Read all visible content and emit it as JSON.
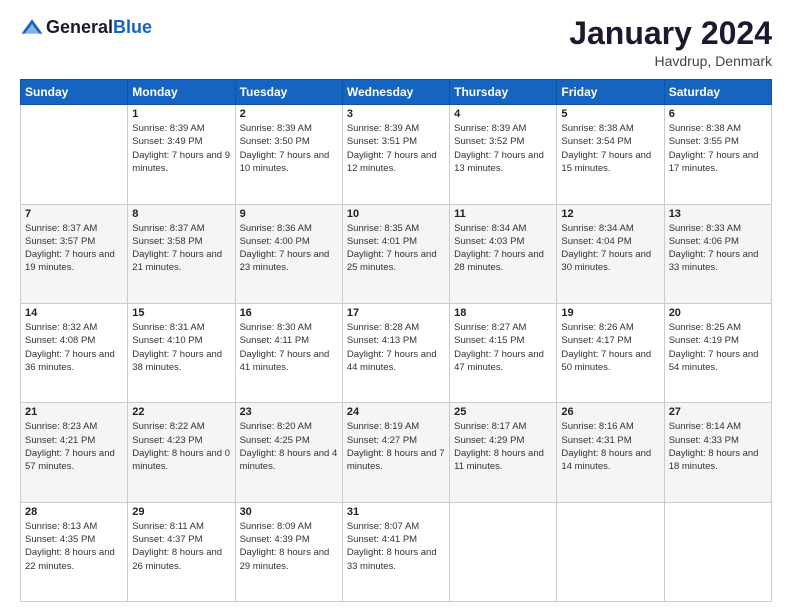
{
  "header": {
    "logo_general": "General",
    "logo_blue": "Blue",
    "month_title": "January 2024",
    "location": "Havdrup, Denmark"
  },
  "days_of_week": [
    "Sunday",
    "Monday",
    "Tuesday",
    "Wednesday",
    "Thursday",
    "Friday",
    "Saturday"
  ],
  "weeks": [
    [
      {
        "num": "",
        "empty": true
      },
      {
        "num": "1",
        "sunrise": "Sunrise: 8:39 AM",
        "sunset": "Sunset: 3:49 PM",
        "daylight": "Daylight: 7 hours and 9 minutes."
      },
      {
        "num": "2",
        "sunrise": "Sunrise: 8:39 AM",
        "sunset": "Sunset: 3:50 PM",
        "daylight": "Daylight: 7 hours and 10 minutes."
      },
      {
        "num": "3",
        "sunrise": "Sunrise: 8:39 AM",
        "sunset": "Sunset: 3:51 PM",
        "daylight": "Daylight: 7 hours and 12 minutes."
      },
      {
        "num": "4",
        "sunrise": "Sunrise: 8:39 AM",
        "sunset": "Sunset: 3:52 PM",
        "daylight": "Daylight: 7 hours and 13 minutes."
      },
      {
        "num": "5",
        "sunrise": "Sunrise: 8:38 AM",
        "sunset": "Sunset: 3:54 PM",
        "daylight": "Daylight: 7 hours and 15 minutes."
      },
      {
        "num": "6",
        "sunrise": "Sunrise: 8:38 AM",
        "sunset": "Sunset: 3:55 PM",
        "daylight": "Daylight: 7 hours and 17 minutes."
      }
    ],
    [
      {
        "num": "7",
        "sunrise": "Sunrise: 8:37 AM",
        "sunset": "Sunset: 3:57 PM",
        "daylight": "Daylight: 7 hours and 19 minutes."
      },
      {
        "num": "8",
        "sunrise": "Sunrise: 8:37 AM",
        "sunset": "Sunset: 3:58 PM",
        "daylight": "Daylight: 7 hours and 21 minutes."
      },
      {
        "num": "9",
        "sunrise": "Sunrise: 8:36 AM",
        "sunset": "Sunset: 4:00 PM",
        "daylight": "Daylight: 7 hours and 23 minutes."
      },
      {
        "num": "10",
        "sunrise": "Sunrise: 8:35 AM",
        "sunset": "Sunset: 4:01 PM",
        "daylight": "Daylight: 7 hours and 25 minutes."
      },
      {
        "num": "11",
        "sunrise": "Sunrise: 8:34 AM",
        "sunset": "Sunset: 4:03 PM",
        "daylight": "Daylight: 7 hours and 28 minutes."
      },
      {
        "num": "12",
        "sunrise": "Sunrise: 8:34 AM",
        "sunset": "Sunset: 4:04 PM",
        "daylight": "Daylight: 7 hours and 30 minutes."
      },
      {
        "num": "13",
        "sunrise": "Sunrise: 8:33 AM",
        "sunset": "Sunset: 4:06 PM",
        "daylight": "Daylight: 7 hours and 33 minutes."
      }
    ],
    [
      {
        "num": "14",
        "sunrise": "Sunrise: 8:32 AM",
        "sunset": "Sunset: 4:08 PM",
        "daylight": "Daylight: 7 hours and 36 minutes."
      },
      {
        "num": "15",
        "sunrise": "Sunrise: 8:31 AM",
        "sunset": "Sunset: 4:10 PM",
        "daylight": "Daylight: 7 hours and 38 minutes."
      },
      {
        "num": "16",
        "sunrise": "Sunrise: 8:30 AM",
        "sunset": "Sunset: 4:11 PM",
        "daylight": "Daylight: 7 hours and 41 minutes."
      },
      {
        "num": "17",
        "sunrise": "Sunrise: 8:28 AM",
        "sunset": "Sunset: 4:13 PM",
        "daylight": "Daylight: 7 hours and 44 minutes."
      },
      {
        "num": "18",
        "sunrise": "Sunrise: 8:27 AM",
        "sunset": "Sunset: 4:15 PM",
        "daylight": "Daylight: 7 hours and 47 minutes."
      },
      {
        "num": "19",
        "sunrise": "Sunrise: 8:26 AM",
        "sunset": "Sunset: 4:17 PM",
        "daylight": "Daylight: 7 hours and 50 minutes."
      },
      {
        "num": "20",
        "sunrise": "Sunrise: 8:25 AM",
        "sunset": "Sunset: 4:19 PM",
        "daylight": "Daylight: 7 hours and 54 minutes."
      }
    ],
    [
      {
        "num": "21",
        "sunrise": "Sunrise: 8:23 AM",
        "sunset": "Sunset: 4:21 PM",
        "daylight": "Daylight: 7 hours and 57 minutes."
      },
      {
        "num": "22",
        "sunrise": "Sunrise: 8:22 AM",
        "sunset": "Sunset: 4:23 PM",
        "daylight": "Daylight: 8 hours and 0 minutes."
      },
      {
        "num": "23",
        "sunrise": "Sunrise: 8:20 AM",
        "sunset": "Sunset: 4:25 PM",
        "daylight": "Daylight: 8 hours and 4 minutes."
      },
      {
        "num": "24",
        "sunrise": "Sunrise: 8:19 AM",
        "sunset": "Sunset: 4:27 PM",
        "daylight": "Daylight: 8 hours and 7 minutes."
      },
      {
        "num": "25",
        "sunrise": "Sunrise: 8:17 AM",
        "sunset": "Sunset: 4:29 PM",
        "daylight": "Daylight: 8 hours and 11 minutes."
      },
      {
        "num": "26",
        "sunrise": "Sunrise: 8:16 AM",
        "sunset": "Sunset: 4:31 PM",
        "daylight": "Daylight: 8 hours and 14 minutes."
      },
      {
        "num": "27",
        "sunrise": "Sunrise: 8:14 AM",
        "sunset": "Sunset: 4:33 PM",
        "daylight": "Daylight: 8 hours and 18 minutes."
      }
    ],
    [
      {
        "num": "28",
        "sunrise": "Sunrise: 8:13 AM",
        "sunset": "Sunset: 4:35 PM",
        "daylight": "Daylight: 8 hours and 22 minutes."
      },
      {
        "num": "29",
        "sunrise": "Sunrise: 8:11 AM",
        "sunset": "Sunset: 4:37 PM",
        "daylight": "Daylight: 8 hours and 26 minutes."
      },
      {
        "num": "30",
        "sunrise": "Sunrise: 8:09 AM",
        "sunset": "Sunset: 4:39 PM",
        "daylight": "Daylight: 8 hours and 29 minutes."
      },
      {
        "num": "31",
        "sunrise": "Sunrise: 8:07 AM",
        "sunset": "Sunset: 4:41 PM",
        "daylight": "Daylight: 8 hours and 33 minutes."
      },
      {
        "num": "",
        "empty": true
      },
      {
        "num": "",
        "empty": true
      },
      {
        "num": "",
        "empty": true
      }
    ]
  ]
}
